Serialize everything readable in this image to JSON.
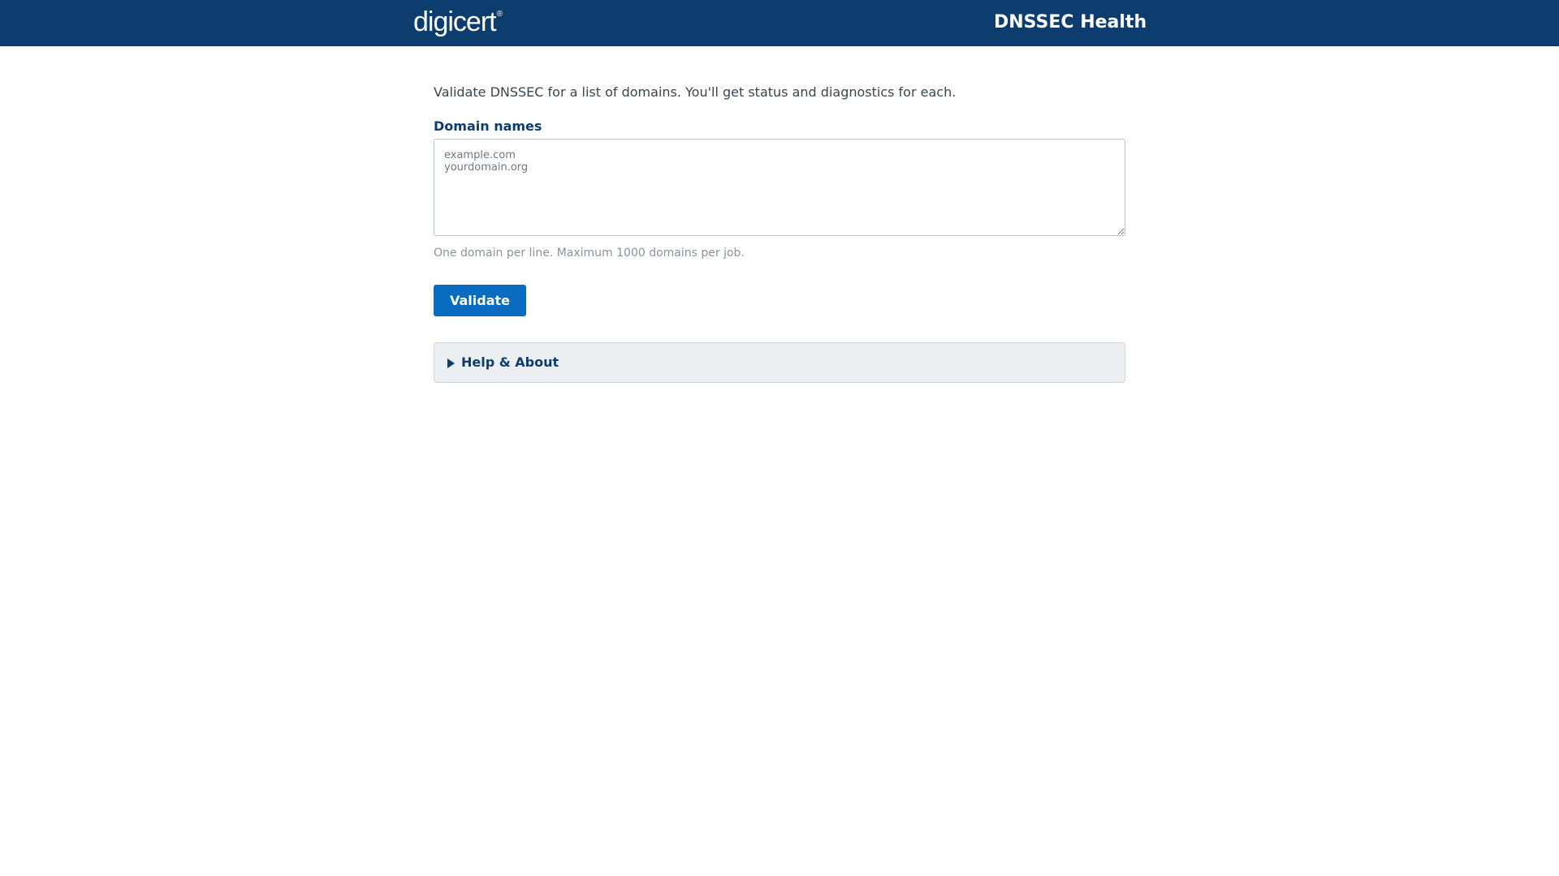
{
  "header": {
    "logo_text": "digicert",
    "logo_mark": "®",
    "app_title": "DNSSEC Health"
  },
  "main": {
    "intro": "Validate DNSSEC for a list of domains. You'll get status and diagnostics for each.",
    "domains_label": "Domain names",
    "domains_value": "",
    "domains_placeholder": "example.com\nyourdomain.org",
    "hint": "One domain per line. Maximum 1000 domains per job.",
    "validate_label": "Validate",
    "help_label": "Help & About"
  },
  "colors": {
    "header_bg": "#0d3d6e",
    "primary_button": "#0a6cc0",
    "label_color": "#0d3d6e",
    "panel_bg": "#eceff1"
  },
  "icons": {
    "help_toggle": "disclosure-triangle-right-icon"
  }
}
